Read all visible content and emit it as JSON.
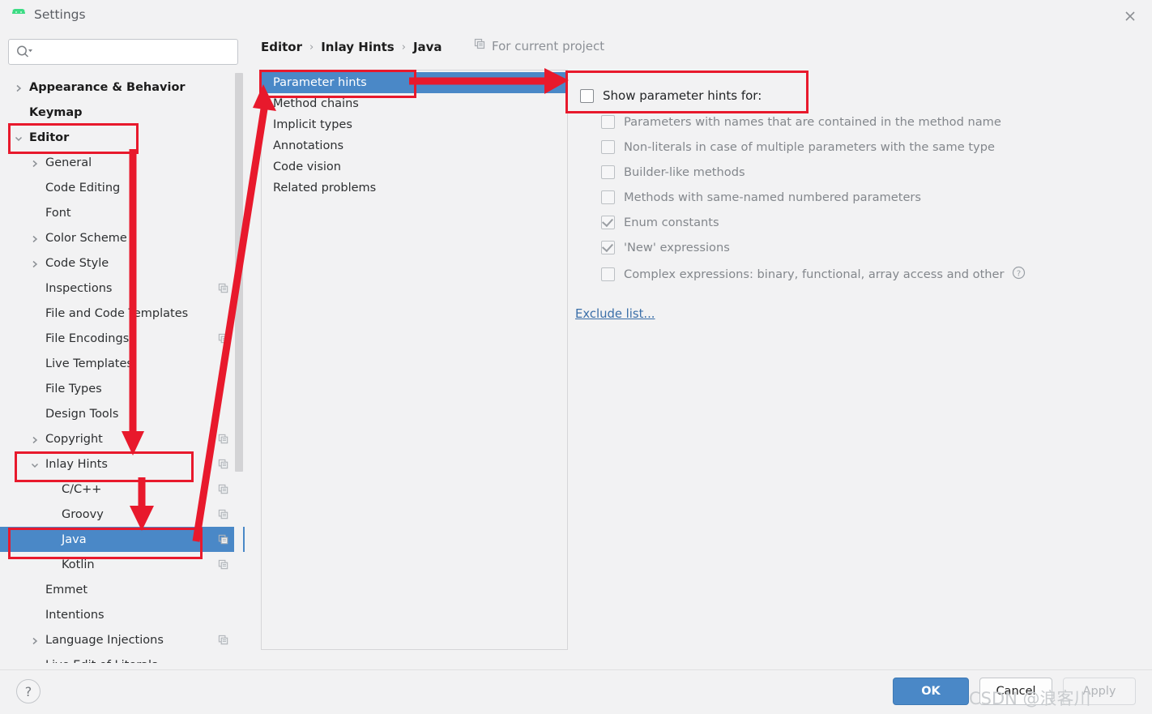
{
  "window": {
    "title": "Settings",
    "app_icon": "android-robot-icon",
    "close_icon": "close-icon"
  },
  "search": {
    "placeholder": "",
    "value": "",
    "icon": "search-icon",
    "dropdown_icon": "chevron-down-icon"
  },
  "sidebar": {
    "scrollbar": "vertical-scrollbar",
    "items": [
      {
        "label": "Appearance & Behavior",
        "indent": 0,
        "chevron": "right",
        "bold": true,
        "selected": false,
        "scope_icon": false
      },
      {
        "label": "Keymap",
        "indent": 0,
        "chevron": "none",
        "bold": true,
        "selected": false,
        "scope_icon": false
      },
      {
        "label": "Editor",
        "indent": 0,
        "chevron": "down",
        "bold": true,
        "selected": false,
        "scope_icon": false
      },
      {
        "label": "General",
        "indent": 1,
        "chevron": "right",
        "bold": false,
        "selected": false,
        "scope_icon": false
      },
      {
        "label": "Code Editing",
        "indent": 1,
        "chevron": "none",
        "bold": false,
        "selected": false,
        "scope_icon": false
      },
      {
        "label": "Font",
        "indent": 1,
        "chevron": "none",
        "bold": false,
        "selected": false,
        "scope_icon": false
      },
      {
        "label": "Color Scheme",
        "indent": 1,
        "chevron": "right",
        "bold": false,
        "selected": false,
        "scope_icon": false
      },
      {
        "label": "Code Style",
        "indent": 1,
        "chevron": "right",
        "bold": false,
        "selected": false,
        "scope_icon": false
      },
      {
        "label": "Inspections",
        "indent": 1,
        "chevron": "none",
        "bold": false,
        "selected": false,
        "scope_icon": true
      },
      {
        "label": "File and Code Templates",
        "indent": 1,
        "chevron": "none",
        "bold": false,
        "selected": false,
        "scope_icon": false
      },
      {
        "label": "File Encodings",
        "indent": 1,
        "chevron": "none",
        "bold": false,
        "selected": false,
        "scope_icon": true
      },
      {
        "label": "Live Templates",
        "indent": 1,
        "chevron": "none",
        "bold": false,
        "selected": false,
        "scope_icon": false
      },
      {
        "label": "File Types",
        "indent": 1,
        "chevron": "none",
        "bold": false,
        "selected": false,
        "scope_icon": false
      },
      {
        "label": "Design Tools",
        "indent": 1,
        "chevron": "none",
        "bold": false,
        "selected": false,
        "scope_icon": false
      },
      {
        "label": "Copyright",
        "indent": 1,
        "chevron": "right",
        "bold": false,
        "selected": false,
        "scope_icon": true
      },
      {
        "label": "Inlay Hints",
        "indent": 1,
        "chevron": "down",
        "bold": false,
        "selected": false,
        "scope_icon": true
      },
      {
        "label": "C/C++",
        "indent": 2,
        "chevron": "none",
        "bold": false,
        "selected": false,
        "scope_icon": true
      },
      {
        "label": "Groovy",
        "indent": 2,
        "chevron": "none",
        "bold": false,
        "selected": false,
        "scope_icon": true
      },
      {
        "label": "Java",
        "indent": 2,
        "chevron": "none",
        "bold": false,
        "selected": true,
        "scope_icon": true
      },
      {
        "label": "Kotlin",
        "indent": 2,
        "chevron": "none",
        "bold": false,
        "selected": false,
        "scope_icon": true
      },
      {
        "label": "Emmet",
        "indent": 1,
        "chevron": "none",
        "bold": false,
        "selected": false,
        "scope_icon": false
      },
      {
        "label": "Intentions",
        "indent": 1,
        "chevron": "none",
        "bold": false,
        "selected": false,
        "scope_icon": false
      },
      {
        "label": "Language Injections",
        "indent": 1,
        "chevron": "right",
        "bold": false,
        "selected": false,
        "scope_icon": true
      },
      {
        "label": "Live Edit of Literals",
        "indent": 1,
        "chevron": "none",
        "bold": false,
        "selected": false,
        "scope_icon": false
      }
    ]
  },
  "breadcrumb": {
    "items": [
      "Editor",
      "Inlay Hints",
      "Java"
    ],
    "separator": "›",
    "scope_label": "For current project",
    "scope_icon": "copy-scope-icon"
  },
  "hint_list": {
    "items": [
      {
        "label": "Parameter hints",
        "selected": true
      },
      {
        "label": "Method chains",
        "selected": false
      },
      {
        "label": "Implicit types",
        "selected": false
      },
      {
        "label": "Annotations",
        "selected": false
      },
      {
        "label": "Code vision",
        "selected": false
      },
      {
        "label": "Related problems",
        "selected": false
      }
    ]
  },
  "options": {
    "root": {
      "label": "Show parameter hints for:",
      "checked": false,
      "disabled": false
    },
    "children": [
      {
        "label": "Parameters with names that are contained in the method name",
        "checked": false,
        "disabled": true,
        "help": false
      },
      {
        "label": "Non-literals in case of multiple parameters with the same type",
        "checked": false,
        "disabled": true,
        "help": false
      },
      {
        "label": "Builder-like methods",
        "checked": false,
        "disabled": true,
        "help": false
      },
      {
        "label": "Methods with same-named numbered parameters",
        "checked": false,
        "disabled": true,
        "help": false
      },
      {
        "label": "Enum constants",
        "checked": true,
        "disabled": true,
        "help": false
      },
      {
        "label": "'New' expressions",
        "checked": true,
        "disabled": true,
        "help": false
      },
      {
        "label": "Complex expressions: binary, functional, array access and other",
        "checked": false,
        "disabled": true,
        "help": true
      }
    ],
    "exclude_link": "Exclude list..."
  },
  "footer": {
    "help_icon": "question-mark-icon",
    "ok_label": "OK",
    "cancel_label": "Cancel",
    "apply_label": "Apply"
  },
  "watermark": {
    "text": "CSDN @浪客川"
  },
  "annotation": {
    "color": "#e8192c"
  }
}
